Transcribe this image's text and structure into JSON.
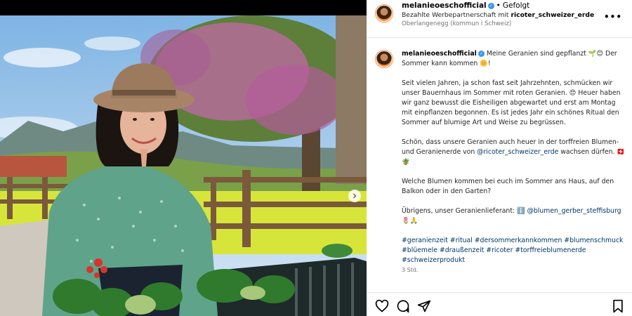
{
  "post": {
    "username": "melanieoeschofficial",
    "follow_status": "Gefolgt",
    "partnership_prefix": "Bezahlte Werbepartnerschaft mit",
    "partner": "ricoter_schweizer_erde",
    "location": "Oberlangenegg (kommun i Schweiz)"
  },
  "caption": {
    "username": "melanieoeschofficial",
    "line1": "Meine Geranien sind gepflanzt 🌱😊 Der Sommer kann kommen 🌼!",
    "para1": "Seit vielen Jahren, ja schon fast seit Jahrzehnten, schmücken wir unser Bauernhaus im Sommer mit roten Geranien. 😍 Heuer haben wir ganz bewusst die Eisheiligen abgewartet und erst am Montag mit einpflanzen begonnen. Es ist jedes Jahr ein schönes Ritual den Sommer auf blumige Art und Weise zu begrüssen.",
    "para2_a": "Schön, dass unsere Geranien auch heuer in der torffreien Blumen- und Geranienerde von ",
    "para2_mention": "@ricoter_schweizer_erde",
    "para2_b": " wachsen dürfen. 🇨🇭🪴",
    "para3": "Welche Blumen kommen bei euch im Sommer ans Haus, auf den Balkon oder in den Garten?",
    "para4_a": "Übrigens, unser Geranienlieferant: ℹ️ ",
    "para4_mention": "@blumen_gerber_steffisburg",
    "para4_b": "🌷🙏",
    "hashtags": "#geranienzeit #ritual #dersommerkannkommen #blumenschmuck #blüemele #draußenzeit #ricoter #torffreieblumenerde #schweizerprodukt",
    "time": "3 Std."
  },
  "icons": {
    "more": "more-options-icon",
    "like": "heart-icon",
    "comment": "comment-icon",
    "share": "share-icon",
    "save": "bookmark-icon",
    "next": "chevron-right-icon"
  },
  "colors": {
    "link": "#00376b",
    "verified": "#3897f0",
    "muted": "#737373"
  }
}
